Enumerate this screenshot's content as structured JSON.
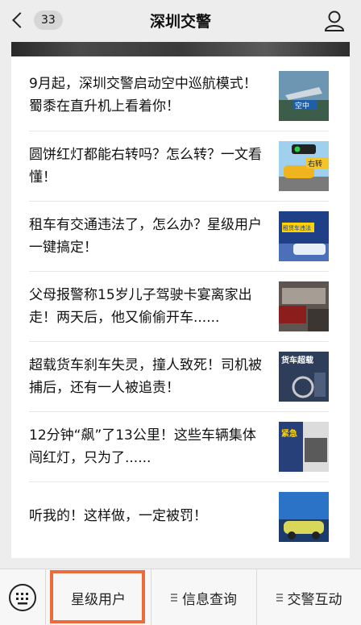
{
  "nav": {
    "title": "深圳交警",
    "back_count": "33"
  },
  "articles": [
    {
      "text": "9月起，深圳交警启动空中巡航模式！蜀黍在直升机上看着你！",
      "thumb_caption": "空中"
    },
    {
      "text": "圆饼红灯都能右转吗？怎么转？一文看懂！",
      "thumb_caption": "右转"
    },
    {
      "text": "租车有交通违法了，怎么办？星级用户一键搞定！",
      "thumb_caption": "租赁车违法"
    },
    {
      "text": "父母报警称15岁儿子驾驶卡宴离家出走！两天后，他又偷偷开车......",
      "thumb_caption": ""
    },
    {
      "text": "超载货车刹车失灵，撞人致死！司机被捕后，还有一人被追责！",
      "thumb_caption": "货车超载"
    },
    {
      "text": "12分钟“飙”了13公里！这些车辆集体闯红灯，只为了......",
      "thumb_caption": "紧急"
    },
    {
      "text": "听我的！这样做，一定被罚！",
      "thumb_caption": ""
    }
  ],
  "menu": {
    "items": [
      "星级用户",
      "信息查询",
      "交警互动"
    ]
  }
}
